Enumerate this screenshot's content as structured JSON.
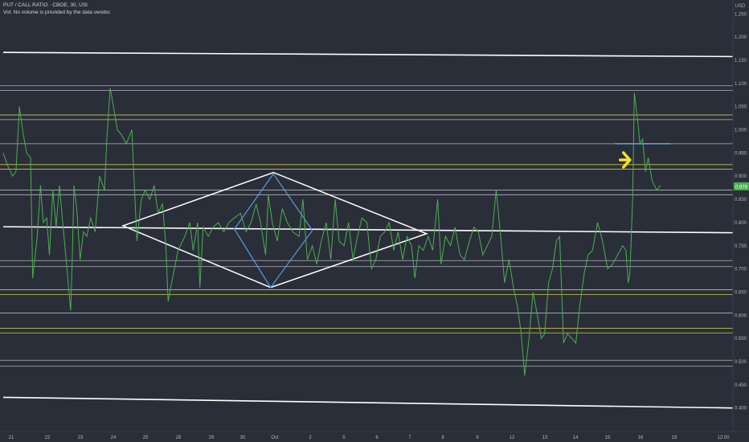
{
  "header": {
    "title": "PUT / CALL RATIO · CBOE, 30, USI",
    "volume_note": "Vol: No volume is provided by the data vendor."
  },
  "chart_data": {
    "type": "line",
    "currency": "USD",
    "y_ticks": [
      "1.250",
      "1.200",
      "1.150",
      "1.100",
      "1.050",
      "1.000",
      "0.950",
      "0.900",
      "0.850",
      "0.800",
      "0.750",
      "0.700",
      "0.650",
      "0.600",
      "0.550",
      "0.500",
      "0.450",
      "0.400"
    ],
    "ylim": [
      0.37,
      1.28
    ],
    "x_ticks": [
      "21",
      "22",
      "23",
      "24",
      "25",
      "28",
      "29",
      "30",
      "Oct",
      "2",
      "5",
      "6",
      "7",
      "8",
      "9",
      "12",
      "13",
      "14",
      "15",
      "16",
      "19",
      "12:00"
    ],
    "last_price_label": "0.878",
    "colors": {
      "background": "#2a2e39",
      "price_line": "#4caf50",
      "last_price_badge": "#4caf50",
      "white_lines": "#ffffff",
      "gray_lines": "#b2b5be",
      "yellow_lines": "#c8c84a",
      "blue_drawing": "#5b9bd5",
      "arrow": "#f5e12a"
    },
    "series": [
      {
        "values": [
          [
            0.0,
            0.95
          ],
          [
            0.9,
            0.92
          ],
          [
            1.7,
            0.9
          ],
          [
            2.3,
            0.91
          ],
          [
            2.9,
            1.05
          ],
          [
            3.6,
            0.99
          ],
          [
            4.2,
            0.95
          ],
          [
            4.9,
            0.94
          ],
          [
            5.3,
            0.68
          ],
          [
            6.1,
            0.77
          ],
          [
            6.7,
            0.88
          ],
          [
            7.2,
            0.8
          ],
          [
            7.8,
            0.81
          ],
          [
            8.3,
            0.73
          ],
          [
            8.9,
            0.87
          ],
          [
            9.5,
            0.79
          ],
          [
            10.1,
            0.88
          ],
          [
            10.6,
            0.81
          ],
          [
            11.3,
            0.72
          ],
          [
            12.1,
            0.61
          ],
          [
            12.4,
            0.72
          ],
          [
            12.7,
            0.88
          ],
          [
            13.2,
            0.83
          ],
          [
            13.8,
            0.72
          ],
          [
            14.4,
            0.78
          ],
          [
            15.0,
            0.77
          ],
          [
            15.7,
            0.81
          ],
          [
            16.5,
            0.78
          ],
          [
            17.3,
            0.9
          ],
          [
            18.2,
            0.87
          ],
          [
            18.6,
            0.98
          ],
          [
            19.2,
            1.09
          ],
          [
            19.8,
            1.05
          ],
          [
            20.5,
            1.0
          ],
          [
            21.2,
            0.99
          ],
          [
            22.1,
            0.97
          ],
          [
            23.1,
            1.0
          ],
          [
            23.5,
            0.89
          ],
          [
            24.0,
            0.76
          ],
          [
            24.8,
            0.85
          ],
          [
            25.5,
            0.87
          ],
          [
            26.3,
            0.85
          ],
          [
            27.1,
            0.88
          ],
          [
            27.8,
            0.82
          ],
          [
            28.6,
            0.84
          ],
          [
            29.2,
            0.75
          ],
          [
            29.6,
            0.63
          ],
          [
            30.4,
            0.68
          ],
          [
            31.4,
            0.74
          ],
          [
            32.6,
            0.77
          ],
          [
            33.5,
            0.8
          ],
          [
            34.1,
            0.74
          ],
          [
            34.9,
            0.8
          ],
          [
            35.3,
            0.66
          ],
          [
            35.9,
            0.79
          ],
          [
            36.8,
            0.77
          ],
          [
            37.7,
            0.79
          ],
          [
            38.6,
            0.8
          ],
          [
            39.6,
            0.78
          ],
          [
            40.5,
            0.8
          ],
          [
            41.5,
            0.81
          ],
          [
            42.6,
            0.82
          ],
          [
            43.6,
            0.78
          ],
          [
            44.5,
            0.8
          ],
          [
            45.4,
            0.84
          ],
          [
            46.2,
            0.8
          ],
          [
            47.1,
            0.73
          ],
          [
            47.6,
            0.86
          ],
          [
            48.3,
            0.8
          ],
          [
            49.2,
            0.76
          ],
          [
            50.1,
            0.83
          ],
          [
            51.0,
            0.8
          ],
          [
            52.0,
            0.78
          ],
          [
            53.1,
            0.77
          ],
          [
            53.8,
            0.85
          ],
          [
            54.6,
            0.72
          ],
          [
            55.5,
            0.75
          ],
          [
            56.3,
            0.71
          ],
          [
            57.1,
            0.76
          ],
          [
            58.0,
            0.8
          ],
          [
            58.8,
            0.72
          ],
          [
            59.6,
            0.85
          ],
          [
            60.3,
            0.76
          ],
          [
            61.2,
            0.75
          ],
          [
            62.0,
            0.8
          ],
          [
            62.8,
            0.72
          ],
          [
            63.6,
            0.77
          ],
          [
            64.4,
            0.81
          ],
          [
            65.3,
            0.8
          ],
          [
            66.1,
            0.7
          ],
          [
            66.9,
            0.72
          ],
          [
            67.7,
            0.77
          ],
          [
            68.5,
            0.78
          ],
          [
            69.3,
            0.8
          ],
          [
            70.1,
            0.74
          ],
          [
            70.9,
            0.78
          ],
          [
            71.7,
            0.72
          ],
          [
            72.5,
            0.77
          ],
          [
            73.3,
            0.75
          ],
          [
            73.9,
            0.68
          ],
          [
            74.6,
            0.75
          ],
          [
            75.4,
            0.74
          ],
          [
            76.3,
            0.77
          ],
          [
            77.1,
            0.74
          ],
          [
            78.0,
            0.85
          ],
          [
            78.6,
            0.71
          ],
          [
            79.4,
            0.77
          ],
          [
            80.3,
            0.75
          ],
          [
            81.1,
            0.79
          ],
          [
            82.0,
            0.73
          ],
          [
            82.8,
            0.72
          ],
          [
            83.7,
            0.76
          ],
          [
            84.5,
            0.79
          ],
          [
            85.3,
            0.78
          ],
          [
            86.1,
            0.73
          ],
          [
            86.9,
            0.75
          ],
          [
            87.7,
            0.77
          ],
          [
            88.5,
            0.87
          ],
          [
            89.3,
            0.77
          ],
          [
            90.0,
            0.67
          ],
          [
            90.8,
            0.72
          ],
          [
            91.6,
            0.66
          ],
          [
            92.3,
            0.62
          ],
          [
            93.0,
            0.56
          ],
          [
            93.6,
            0.47
          ],
          [
            94.4,
            0.55
          ],
          [
            95.1,
            0.65
          ],
          [
            95.9,
            0.6
          ],
          [
            96.6,
            0.55
          ],
          [
            97.2,
            0.56
          ],
          [
            97.9,
            0.67
          ],
          [
            98.6,
            0.7
          ],
          [
            99.3,
            0.76
          ],
          [
            99.9,
            0.77
          ],
          [
            100.6,
            0.54
          ],
          [
            101.3,
            0.56
          ],
          [
            102.1,
            0.55
          ],
          [
            102.8,
            0.54
          ],
          [
            103.5,
            0.62
          ],
          [
            104.3,
            0.69
          ],
          [
            105.0,
            0.73
          ],
          [
            105.8,
            0.74
          ],
          [
            106.7,
            0.8
          ],
          [
            107.6,
            0.76
          ],
          [
            108.5,
            0.7
          ],
          [
            109.4,
            0.71
          ],
          [
            110.3,
            0.73
          ],
          [
            111.2,
            0.75
          ],
          [
            111.8,
            0.74
          ],
          [
            112.2,
            0.67
          ],
          [
            112.5,
            0.69
          ],
          [
            113.0,
            0.85
          ],
          [
            113.3,
            1.08
          ],
          [
            113.9,
            1.02
          ],
          [
            114.3,
            0.97
          ],
          [
            114.8,
            0.98
          ],
          [
            115.3,
            0.91
          ],
          [
            115.8,
            0.94
          ],
          [
            116.5,
            0.89
          ],
          [
            117.3,
            0.87
          ],
          [
            118.0,
            0.88
          ]
        ]
      }
    ],
    "horizontal_levels": {
      "white": [
        1.163,
        0.788,
        0.408
      ],
      "gray": [
        1.095,
        1.085,
        0.97,
        0.87,
        0.86,
        0.718,
        0.705,
        0.605,
        0.503,
        0.49
      ],
      "yellow": [
        1.032,
        1.022,
        0.925,
        0.915,
        0.655,
        0.645,
        0.572,
        0.562
      ]
    },
    "trend_lines": [
      {
        "from": [
          0.0,
          0.791
        ],
        "to": [
          131.0,
          0.778
        ]
      },
      {
        "from": [
          0.0,
          1.167
        ],
        "to": [
          131.0,
          1.158
        ]
      },
      {
        "from": [
          0.0,
          0.423
        ],
        "to": [
          131.0,
          0.4
        ]
      }
    ],
    "drawings": {
      "diamond_outer": [
        [
          21.5,
          0.793
        ],
        [
          48.5,
          0.908
        ],
        [
          76.0,
          0.776
        ],
        [
          48.0,
          0.66
        ]
      ],
      "diamond_inner": [
        [
          41.5,
          0.786
        ],
        [
          48.5,
          0.905
        ],
        [
          55.5,
          0.783
        ],
        [
          48.0,
          0.66
        ]
      ],
      "blue_segment": {
        "from": [
          109.8,
          0.97
        ],
        "to": [
          119.8,
          0.97
        ]
      },
      "arrow_at": [
        112.5,
        0.935
      ]
    }
  }
}
